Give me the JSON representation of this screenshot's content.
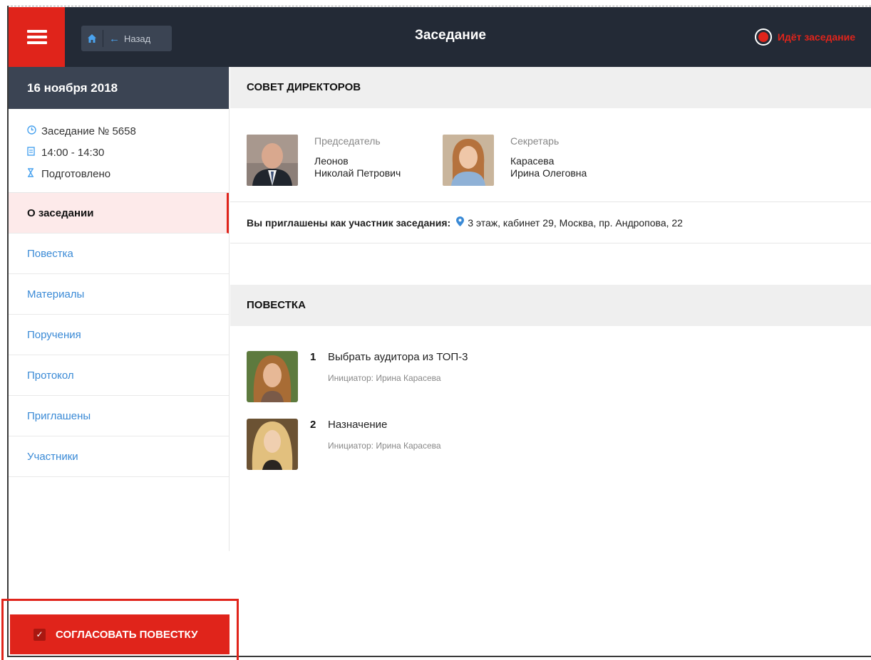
{
  "topbar": {
    "back_label": "Назад",
    "title": "Заседание",
    "status": "Идёт заседание"
  },
  "sidebar": {
    "date": "16 ноября 2018",
    "meeting_number": "Заседание № 5658",
    "time": "14:00 - 14:30",
    "state": "Подготовлено",
    "items": [
      {
        "label": "О заседании",
        "active": true
      },
      {
        "label": "Повестка"
      },
      {
        "label": "Материалы"
      },
      {
        "label": "Поручения"
      },
      {
        "label": "Протокол"
      },
      {
        "label": "Приглашены"
      },
      {
        "label": "Участники"
      }
    ]
  },
  "main": {
    "council_title": "СОВЕТ ДИРЕКТОРОВ",
    "chair": {
      "role": "Председатель",
      "surname": "Леонов",
      "given": "Николай Петрович"
    },
    "secretary": {
      "role": "Секретарь",
      "surname": "Карасева",
      "given": "Ирина Олеговна"
    },
    "invite_label": "Вы приглашены как участник заседания:",
    "location": "3 этаж, кабинет 29, Москва, пр. Андропова, 22",
    "agenda_title": "ПОВЕСТКА",
    "agenda": [
      {
        "num": "1",
        "title": "Выбрать аудитора из ТОП-3",
        "initiator": "Инициатор: Ирина Карасева"
      },
      {
        "num": "2",
        "title": "Назначение",
        "initiator": "Инициатор: Ирина Карасева"
      }
    ]
  },
  "footer": {
    "approve_label": "СОГЛАСОВАТЬ ПОВЕСТКУ"
  },
  "colors": {
    "accent": "#e0241b",
    "topbar": "#232a36",
    "link": "#3a8ad6"
  }
}
